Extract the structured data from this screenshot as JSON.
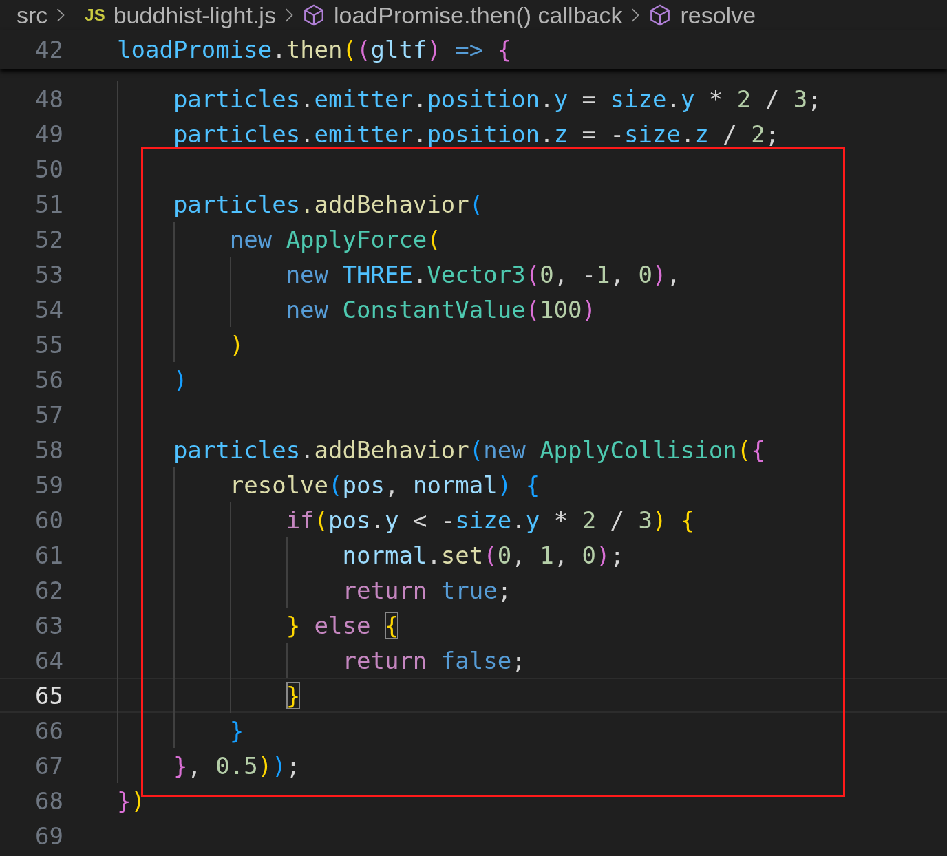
{
  "breadcrumb": [
    {
      "kind": "folder",
      "label": "src"
    },
    {
      "kind": "file",
      "badge": "JS",
      "label": "buddhist-light.js"
    },
    {
      "kind": "symbol",
      "label": "loadPromise.then() callback"
    },
    {
      "kind": "symbol",
      "label": "resolve"
    }
  ],
  "sticky_line": {
    "number": "42",
    "current": false,
    "tokens": [
      {
        "t": "loadPromise",
        "color": "#4fc1ff"
      },
      {
        "t": ".",
        "color": "#d4d4d4"
      },
      {
        "t": "then",
        "color": "#dcdcaa"
      },
      {
        "t": "(",
        "color": "#ffd700"
      },
      {
        "t": "(",
        "color": "#da70d6"
      },
      {
        "t": "gltf",
        "color": "#9cdcfe"
      },
      {
        "t": ")",
        "color": "#da70d6"
      },
      {
        "t": " => ",
        "color": "#569cd6"
      },
      {
        "t": "{",
        "color": "#da70d6"
      }
    ],
    "children": [
      {
        "number": "48",
        "current": false,
        "tokens": [
          {
            "t": "particles",
            "color": "#4fc1ff"
          },
          {
            "t": ".",
            "color": "#d4d4d4"
          },
          {
            "t": "emitter",
            "color": "#4fc1ff"
          },
          {
            "t": ".",
            "color": "#d4d4d4"
          },
          {
            "t": "position",
            "color": "#4fc1ff"
          },
          {
            "t": ".",
            "color": "#d4d4d4"
          },
          {
            "t": "y",
            "color": "#4fc1ff"
          },
          {
            "t": " = ",
            "color": "#d4d4d4"
          },
          {
            "t": "size",
            "color": "#4fc1ff"
          },
          {
            "t": ".",
            "color": "#d4d4d4"
          },
          {
            "t": "y",
            "color": "#4fc1ff"
          },
          {
            "t": " * ",
            "color": "#d4d4d4"
          },
          {
            "t": "2",
            "color": "#b5cea8"
          },
          {
            "t": " / ",
            "color": "#d4d4d4"
          },
          {
            "t": "3",
            "color": "#b5cea8"
          },
          {
            "t": ";",
            "color": "#d4d4d4"
          }
        ]
      },
      {
        "number": "49",
        "current": false,
        "tokens": [
          {
            "t": "particles",
            "color": "#4fc1ff"
          },
          {
            "t": ".",
            "color": "#d4d4d4"
          },
          {
            "t": "emitter",
            "color": "#4fc1ff"
          },
          {
            "t": ".",
            "color": "#d4d4d4"
          },
          {
            "t": "position",
            "color": "#4fc1ff"
          },
          {
            "t": ".",
            "color": "#d4d4d4"
          },
          {
            "t": "z",
            "color": "#4fc1ff"
          },
          {
            "t": " = -",
            "color": "#d4d4d4"
          },
          {
            "t": "size",
            "color": "#4fc1ff"
          },
          {
            "t": ".",
            "color": "#d4d4d4"
          },
          {
            "t": "z",
            "color": "#4fc1ff"
          },
          {
            "t": " / ",
            "color": "#d4d4d4"
          },
          {
            "t": "2",
            "color": "#b5cea8"
          },
          {
            "t": ";",
            "color": "#d4d4d4"
          }
        ]
      },
      {
        "number": "50",
        "current": false
      },
      {
        "number": "51",
        "current": false,
        "tokens": [
          {
            "t": "particles",
            "color": "#4fc1ff"
          },
          {
            "t": ".addBehavior",
            "color": "#dcdcaa"
          },
          {
            "t": "(",
            "color": "#179fff"
          }
        ],
        "children": [
          {
            "number": "52",
            "current": false,
            "tokens": [
              {
                "t": "new ",
                "color": "#569cd6"
              },
              {
                "t": "ApplyForce",
                "color": "#4ec9b0"
              },
              {
                "t": "(",
                "color": "#ffd700"
              }
            ],
            "children": [
              {
                "number": "53",
                "current": false,
                "tokens": [
                  {
                    "t": "new ",
                    "color": "#569cd6"
                  },
                  {
                    "t": "THREE",
                    "color": "#4fc1ff"
                  },
                  {
                    "t": ".",
                    "color": "#d4d4d4"
                  },
                  {
                    "t": "Vector3",
                    "color": "#4ec9b0"
                  },
                  {
                    "t": "(",
                    "color": "#da70d6"
                  },
                  {
                    "t": "0",
                    "color": "#b5cea8"
                  },
                  {
                    "t": ", -",
                    "color": "#d4d4d4"
                  },
                  {
                    "t": "1",
                    "color": "#b5cea8"
                  },
                  {
                    "t": ", ",
                    "color": "#d4d4d4"
                  },
                  {
                    "t": "0",
                    "color": "#b5cea8"
                  },
                  {
                    "t": ")",
                    "color": "#da70d6"
                  },
                  {
                    "t": ",",
                    "color": "#d4d4d4"
                  }
                ]
              },
              {
                "number": "54",
                "current": false,
                "tokens": [
                  {
                    "t": "new ",
                    "color": "#569cd6"
                  },
                  {
                    "t": "ConstantValue",
                    "color": "#4ec9b0"
                  },
                  {
                    "t": "(",
                    "color": "#da70d6"
                  },
                  {
                    "t": "100",
                    "color": "#b5cea8"
                  },
                  {
                    "t": ")",
                    "color": "#da70d6"
                  }
                ]
              }
            ]
          },
          {
            "number": "55",
            "current": false,
            "tokens": [
              {
                "t": ")",
                "color": "#ffd700"
              }
            ]
          }
        ]
      },
      {
        "number": "56",
        "current": false,
        "tokens": [
          {
            "t": ")",
            "color": "#179fff"
          }
        ]
      },
      {
        "number": "57",
        "current": false
      },
      {
        "number": "58",
        "current": false,
        "tokens": [
          {
            "t": "particles",
            "color": "#4fc1ff"
          },
          {
            "t": ".",
            "color": "#d4d4d4"
          },
          {
            "t": "addBehavior",
            "color": "#dcdcaa"
          },
          {
            "t": "(",
            "color": "#179fff"
          },
          {
            "t": "new ",
            "color": "#569cd6"
          },
          {
            "t": "ApplyCollision",
            "color": "#4ec9b0"
          },
          {
            "t": "(",
            "color": "#ffd700"
          },
          {
            "t": "{",
            "color": "#da70d6"
          }
        ],
        "children": [
          {
            "number": "59",
            "current": false,
            "tokens": [
              {
                "t": "resolve",
                "color": "#dcdcaa"
              },
              {
                "t": "(",
                "color": "#179fff"
              },
              {
                "t": "pos",
                "color": "#9cdcfe"
              },
              {
                "t": ", ",
                "color": "#d4d4d4"
              },
              {
                "t": "normal",
                "color": "#9cdcfe"
              },
              {
                "t": ")",
                "color": "#179fff"
              },
              {
                "t": " {",
                "color": "#179fff"
              }
            ],
            "children": [
              {
                "number": "60",
                "current": false,
                "tokens": [
                  {
                    "t": "if",
                    "color": "#c586c0"
                  },
                  {
                    "t": "(",
                    "color": "#ffd700"
                  },
                  {
                    "t": "pos",
                    "color": "#9cdcfe"
                  },
                  {
                    "t": ".",
                    "color": "#d4d4d4"
                  },
                  {
                    "t": "y",
                    "color": "#9cdcfe"
                  },
                  {
                    "t": " < -",
                    "color": "#d4d4d4"
                  },
                  {
                    "t": "size",
                    "color": "#4fc1ff"
                  },
                  {
                    "t": ".",
                    "color": "#d4d4d4"
                  },
                  {
                    "t": "y",
                    "color": "#4fc1ff"
                  },
                  {
                    "t": " * ",
                    "color": "#d4d4d4"
                  },
                  {
                    "t": "2",
                    "color": "#b5cea8"
                  },
                  {
                    "t": " / ",
                    "color": "#d4d4d4"
                  },
                  {
                    "t": "3",
                    "color": "#b5cea8"
                  },
                  {
                    "t": ")",
                    "color": "#ffd700"
                  },
                  {
                    "t": " {",
                    "color": "#ffd700"
                  }
                ],
                "children": [
                  {
                    "number": "61",
                    "current": false,
                    "tokens": [
                      {
                        "t": "normal",
                        "color": "#9cdcfe"
                      },
                      {
                        "t": ".",
                        "color": "#d4d4d4"
                      },
                      {
                        "t": "set",
                        "color": "#dcdcaa"
                      },
                      {
                        "t": "(",
                        "color": "#da70d6"
                      },
                      {
                        "t": "0",
                        "color": "#b5cea8"
                      },
                      {
                        "t": ", ",
                        "color": "#d4d4d4"
                      },
                      {
                        "t": "1",
                        "color": "#b5cea8"
                      },
                      {
                        "t": ", ",
                        "color": "#d4d4d4"
                      },
                      {
                        "t": "0",
                        "color": "#b5cea8"
                      },
                      {
                        "t": ")",
                        "color": "#da70d6"
                      },
                      {
                        "t": ";",
                        "color": "#d4d4d4"
                      }
                    ]
                  },
                  {
                    "number": "62",
                    "current": false,
                    "tokens": [
                      {
                        "t": "return ",
                        "color": "#c586c0"
                      },
                      {
                        "t": "true",
                        "color": "#569cd6"
                      },
                      {
                        "t": ";",
                        "color": "#d4d4d4"
                      }
                    ]
                  }
                ]
              },
              {
                "number": "63",
                "current": false,
                "tokens": [
                  {
                    "t": "} ",
                    "color": "#ffd700"
                  },
                  {
                    "t": "else ",
                    "color": "#c586c0"
                  },
                  {
                    "t": "{",
                    "color": "#ffd700",
                    "matched": true
                  }
                ],
                "children": [
                  {
                    "number": "64",
                    "current": false,
                    "tokens": [
                      {
                        "t": "return ",
                        "color": "#c586c0"
                      },
                      {
                        "t": "false",
                        "color": "#569cd6"
                      },
                      {
                        "t": ";",
                        "color": "#d4d4d4"
                      }
                    ]
                  }
                ]
              },
              {
                "number": "65",
                "current": true,
                "tokens": [
                  {
                    "t": "}",
                    "color": "#ffd700",
                    "matched": true
                  }
                ]
              }
            ]
          },
          {
            "number": "66",
            "current": false,
            "tokens": [
              {
                "t": "}",
                "color": "#179fff"
              }
            ]
          }
        ]
      },
      {
        "number": "67",
        "current": false,
        "tokens": [
          {
            "t": "}",
            "color": "#da70d6"
          },
          {
            "t": ", ",
            "color": "#d4d4d4"
          },
          {
            "t": "0.5",
            "color": "#b5cea8"
          },
          {
            "t": ")",
            "color": "#ffd700"
          },
          {
            "t": ")",
            "color": "#179fff"
          },
          {
            "t": ";",
            "color": "#d4d4d4"
          }
        ]
      }
    ]
  },
  "lines": [
    {
      "number": "68",
      "current": false,
      "tokens": [
        {
          "t": "}",
          "color": "#da70d6"
        },
        {
          "t": ")",
          "color": "#ffd700"
        }
      ]
    },
    {
      "number": "69",
      "current": false
    }
  ],
  "annotation": {
    "kind": "rectangle"
  }
}
